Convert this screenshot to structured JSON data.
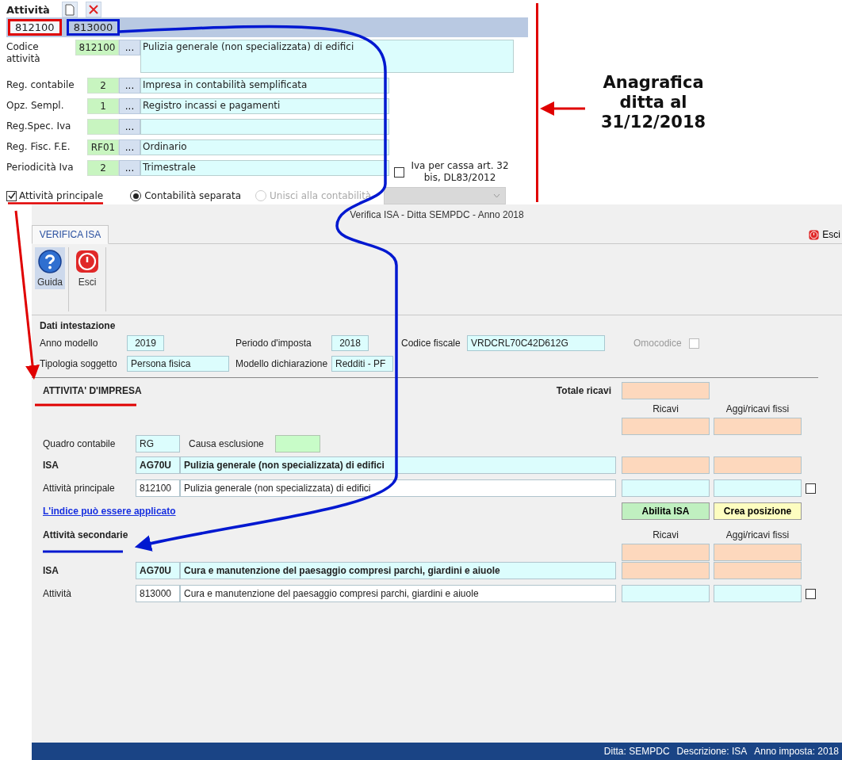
{
  "anagrafica": {
    "title": "Attività",
    "tabs": [
      {
        "label": "812100",
        "selected": true,
        "color": "#e00000"
      },
      {
        "label": "813000",
        "selected": false,
        "color": "#0018d0"
      }
    ],
    "fields": [
      {
        "kind": "tall",
        "label": "Codice attività",
        "code": "812100",
        "description": "Pulizia generale (non specializzata) di edifici"
      },
      {
        "kind": "line",
        "label": "Reg. contabile",
        "code": "2",
        "description": "Impresa  in contabilità semplificata"
      },
      {
        "kind": "line",
        "label": "Opz. Sempl.",
        "code": "1",
        "description": "Registro incassi e pagamenti"
      },
      {
        "kind": "line",
        "label": "Reg.Spec. Iva"
      },
      {
        "kind": "line",
        "label": "Reg. Fisc. F.E.",
        "code": "RF01",
        "description": "Ordinario"
      },
      {
        "kind": "line",
        "label": "Periodicità Iva",
        "code": "2",
        "description": "Trimestrale"
      }
    ],
    "lookup_button": "...",
    "iva_per_cassa": {
      "label": "Iva per cassa art. 32 bis, DL83/2012",
      "checked": false
    },
    "attivita_principale": {
      "label": "Attività principale",
      "checked": true
    },
    "radios": [
      {
        "label": "Contabilità separata",
        "selected": true,
        "disabled": false
      },
      {
        "label": "Unisci alla contabilità",
        "selected": false,
        "disabled": true
      }
    ],
    "dropdown": {
      "disabled": true
    }
  },
  "annotation": {
    "text": "Anagrafica ditta al 31/12/2018"
  },
  "window": {
    "title": "Verifica ISA - Ditta SEMPDC - Anno 2018",
    "tabs": [
      {
        "label": "VERIFICA ISA",
        "selected": true
      }
    ],
    "exit_link": "Esci",
    "toolbar": [
      {
        "kind": "help",
        "label": "Guida",
        "selected": true
      },
      {
        "kind": "exit",
        "label": "Esci",
        "selected": false
      }
    ]
  },
  "dati_intestazione": {
    "title": "Dati intestazione",
    "rows": [
      [
        {
          "label": "Anno modello",
          "value": "2019"
        },
        {
          "label": "Periodo d'imposta",
          "value": "2018"
        },
        {
          "label": "Codice fiscale",
          "value": "VRDCRL70C42D612G"
        }
      ],
      [
        {
          "label": "Tipologia soggetto",
          "value": "Persona fisica"
        },
        {
          "label": "Modello dichiarazione",
          "value": "Redditi - PF"
        }
      ]
    ],
    "omocodice": {
      "label": "Omocodice",
      "checked": false,
      "disabled": true
    }
  },
  "attivita_impresa": {
    "title": "ATTIVITA' D'IMPRESA",
    "totale_label": "Totale ricavi",
    "columns": [
      "Ricavi",
      "Aggi/ricavi fissi"
    ],
    "quadro": {
      "label": "Quadro contabile",
      "value": "RG"
    },
    "causa": {
      "label": "Causa esclusione"
    },
    "rows": [
      {
        "kind": "isa",
        "label": "ISA",
        "code": "AG70U",
        "description": "Pulizia generale (non specializzata) di edifici"
      },
      {
        "kind": "activity",
        "label": "Attività principale",
        "code": "812100",
        "description": "Pulizia generale (non specializzata) di edifici",
        "checked": false
      }
    ],
    "link": "L'indice può essere applicato",
    "buttons": [
      {
        "kind": "enable",
        "label": "Abilita ISA"
      },
      {
        "kind": "create",
        "label": "Crea posizione"
      }
    ]
  },
  "attivita_secondarie": {
    "title": "Attività secondarie",
    "columns": [
      "Ricavi",
      "Aggi/ricavi fissi"
    ],
    "rows": [
      {
        "kind": "isa",
        "label": "ISA",
        "code": "AG70U",
        "description": "Cura e manutenzione del paesaggio compresi parchi, giardini e aiuole"
      },
      {
        "kind": "activity",
        "label": "Attività",
        "code": "813000",
        "description": "Cura e manutenzione del paesaggio compresi parchi, giardini e aiuole",
        "checked": false
      }
    ]
  },
  "status_bar": [
    "Ditta: SEMPDC",
    "Descrizione: ISA",
    "Anno imposta: 2018"
  ]
}
